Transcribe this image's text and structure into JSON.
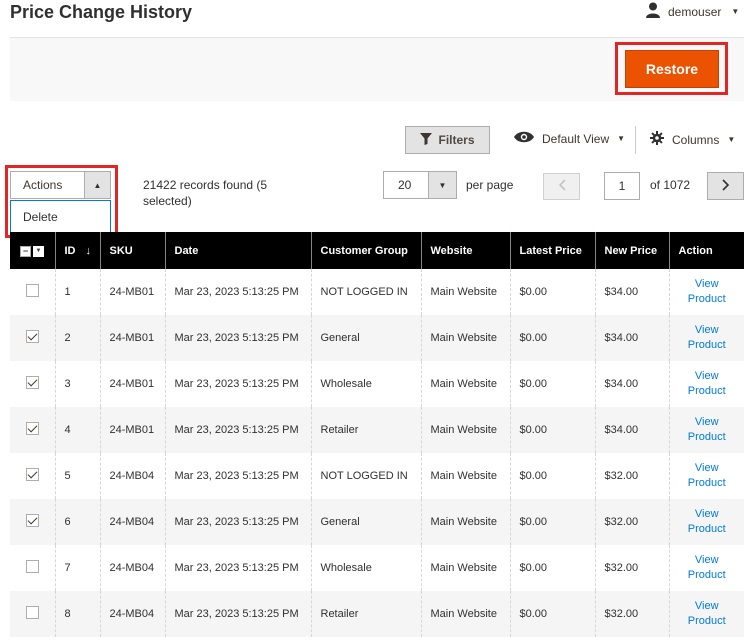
{
  "header": {
    "title": "Price Change History",
    "user": "demouser"
  },
  "toolbar": {
    "restore_label": "Restore",
    "filters_label": "Filters",
    "view_label": "Default View",
    "columns_label": "Columns"
  },
  "mass_actions": {
    "select_label": "Actions",
    "options": [
      "Delete"
    ]
  },
  "records": {
    "count_text": "21422 records found (5 selected)"
  },
  "pagination": {
    "page_size": "20",
    "per_page_label": "per page",
    "current_page": "1",
    "total_pages_text": "of 1072"
  },
  "table": {
    "columns": [
      "ID",
      "SKU",
      "Date",
      "Customer Group",
      "Website",
      "Latest Price",
      "New Price",
      "Action"
    ],
    "sort_indicator": "↓",
    "rows": [
      {
        "checked": false,
        "id": "1",
        "sku": "24-MB01",
        "date": "Mar 23, 2023 5:13:25 PM",
        "group": "NOT LOGGED IN",
        "website": "Main Website",
        "latest": "$0.00",
        "new": "$34.00",
        "action_line1": "View",
        "action_line2": "Product"
      },
      {
        "checked": true,
        "id": "2",
        "sku": "24-MB01",
        "date": "Mar 23, 2023 5:13:25 PM",
        "group": "General",
        "website": "Main Website",
        "latest": "$0.00",
        "new": "$34.00",
        "action_line1": "View",
        "action_line2": "Product"
      },
      {
        "checked": true,
        "id": "3",
        "sku": "24-MB01",
        "date": "Mar 23, 2023 5:13:25 PM",
        "group": "Wholesale",
        "website": "Main Website",
        "latest": "$0.00",
        "new": "$34.00",
        "action_line1": "View",
        "action_line2": "Product"
      },
      {
        "checked": true,
        "id": "4",
        "sku": "24-MB01",
        "date": "Mar 23, 2023 5:13:25 PM",
        "group": "Retailer",
        "website": "Main Website",
        "latest": "$0.00",
        "new": "$34.00",
        "action_line1": "View",
        "action_line2": "Product"
      },
      {
        "checked": true,
        "id": "5",
        "sku": "24-MB04",
        "date": "Mar 23, 2023 5:13:25 PM",
        "group": "NOT LOGGED IN",
        "website": "Main Website",
        "latest": "$0.00",
        "new": "$32.00",
        "action_line1": "View",
        "action_line2": "Product"
      },
      {
        "checked": true,
        "id": "6",
        "sku": "24-MB04",
        "date": "Mar 23, 2023 5:13:25 PM",
        "group": "General",
        "website": "Main Website",
        "latest": "$0.00",
        "new": "$32.00",
        "action_line1": "View",
        "action_line2": "Product"
      },
      {
        "checked": false,
        "id": "7",
        "sku": "24-MB04",
        "date": "Mar 23, 2023 5:13:25 PM",
        "group": "Wholesale",
        "website": "Main Website",
        "latest": "$0.00",
        "new": "$32.00",
        "action_line1": "View",
        "action_line2": "Product"
      },
      {
        "checked": false,
        "id": "8",
        "sku": "24-MB04",
        "date": "Mar 23, 2023 5:13:25 PM",
        "group": "Retailer",
        "website": "Main Website",
        "latest": "$0.00",
        "new": "$32.00",
        "action_line1": "View",
        "action_line2": "Product"
      }
    ]
  },
  "colors": {
    "accent": "#eb5202",
    "highlight": "#e22626",
    "link": "#007bdb",
    "header_bg": "#000000"
  },
  "icons": {
    "user": "user-icon",
    "filter": "funnel-icon",
    "view": "eye-icon",
    "columns": "gear-icon"
  }
}
